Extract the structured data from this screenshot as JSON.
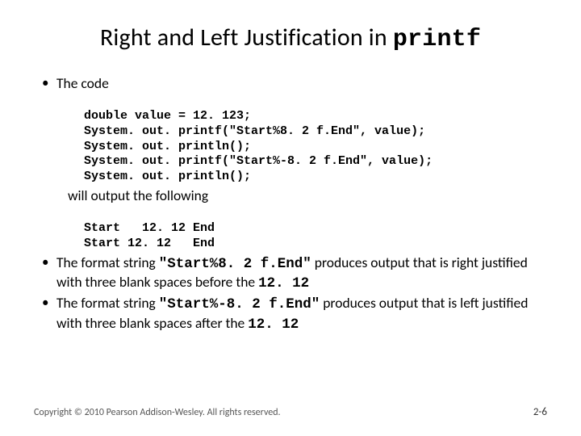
{
  "title_prefix": "Right and Left Justification in ",
  "title_code": "printf",
  "bullets": {
    "b1_intro": "The code",
    "code_lines": [
      "double value = 12. 123;",
      "System. out. printf(\"Start%8. 2 f.End\", value);",
      "System. out. println();",
      "System. out. printf(\"Start%-8. 2 f.End\", value);",
      "System. out. println();"
    ],
    "will_output": "will output the following",
    "output_lines": [
      "Start   12. 12 End",
      "Start 12. 12   End"
    ],
    "b2_before": "The format string ",
    "b2_code": "\"Start%8. 2 f.End\"",
    "b2_mid": " produces output that is right justified with three blank spaces before the ",
    "b2_val": "12. 12",
    "b3_before": "The format string ",
    "b3_code": "\"Start%-8. 2 f.End\"",
    "b3_mid": " produces output that is left justified with three blank spaces after the ",
    "b3_val": "12. 12"
  },
  "footer": {
    "copyright": "Copyright © 2010 Pearson Addison-Wesley. All rights reserved.",
    "page": "2-6"
  }
}
